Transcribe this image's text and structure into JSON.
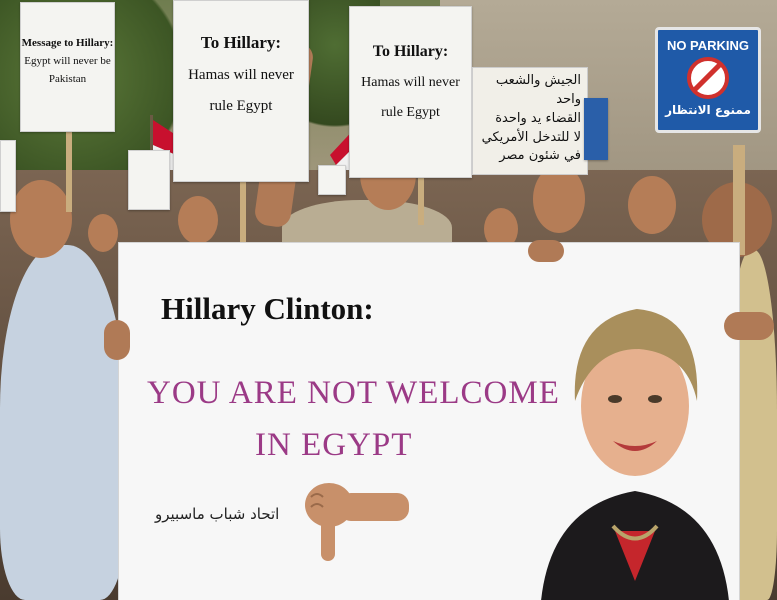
{
  "signs": {
    "message": [
      "Message to Hillary:",
      "Egypt will never be",
      "Pakistan"
    ],
    "hamas_left": [
      "To Hillary:",
      "Hamas will never",
      "rule Egypt"
    ],
    "hamas_right": [
      "To Hillary:",
      "Hamas will never",
      "rule Egypt"
    ],
    "arabic": [
      "الجيش والشعب واحد",
      "القضاء يد واحدة",
      "لا للتدخل الأمريكي",
      "في شئون مصر"
    ]
  },
  "no_parking": {
    "title": "NO PARKING",
    "arabic": "ممنوع الانتظار"
  },
  "banner": {
    "title": "Hillary Clinton:",
    "line1": "YOU ARE NOT WELCOME",
    "line2": "IN EGYPT",
    "arabic": "اتحاد شباب ماسبيرو"
  },
  "colors": {
    "banner_text": "#9b3a86",
    "no_parking_bg": "#1f5aa8"
  }
}
